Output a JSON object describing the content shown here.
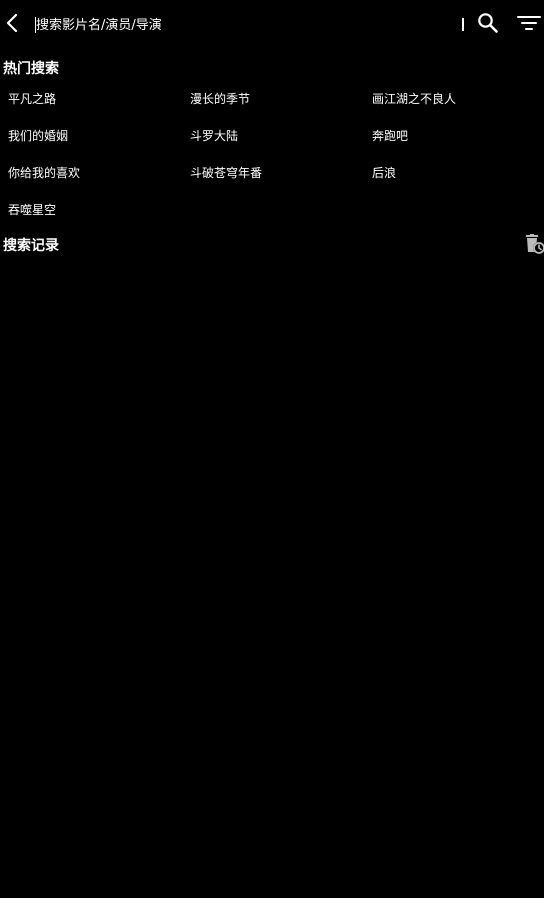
{
  "search": {
    "placeholder": "搜索影片名/演员/导演",
    "value": ""
  },
  "hot_search": {
    "title": "热门搜索",
    "items": [
      "平凡之路",
      "漫长的季节",
      "画江湖之不良人",
      "我们的婚姻",
      "斗罗大陆",
      "奔跑吧",
      "你给我的喜欢",
      "斗破苍穹年番",
      "后浪",
      "吞噬星空"
    ]
  },
  "search_history": {
    "title": "搜索记录",
    "items": []
  },
  "icons": {
    "back": "chevron-left-icon",
    "search": "search-icon",
    "filter": "filter-icon",
    "clear_history": "delete-history-icon"
  },
  "colors": {
    "background": "#000000",
    "text": "#ffffff",
    "icon_secondary": "#bbbbbb"
  }
}
